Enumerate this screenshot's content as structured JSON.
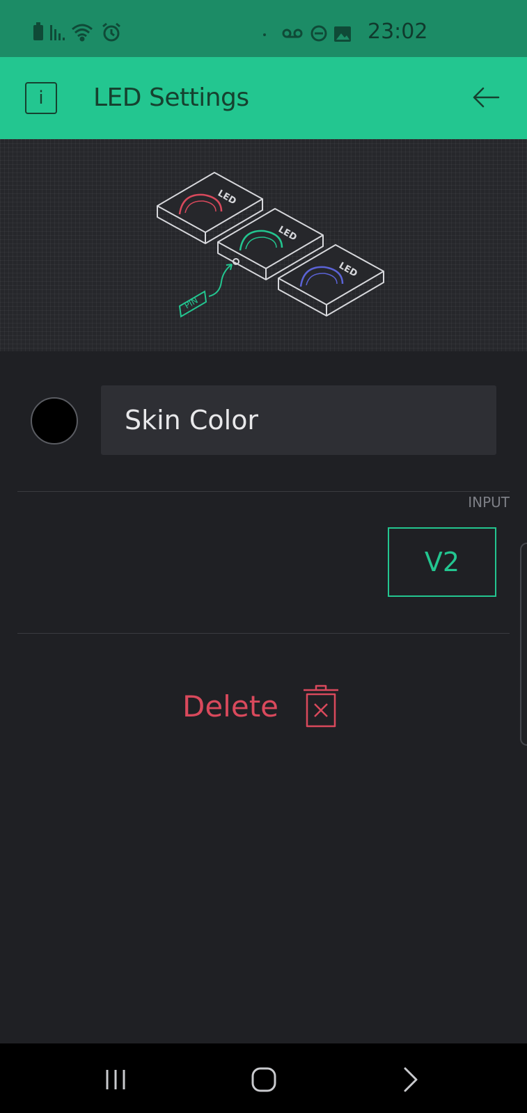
{
  "status_bar": {
    "time": "23:02",
    "icons_left": [
      "battery-icon",
      "signal-icon",
      "wifi-icon",
      "alarm-icon"
    ],
    "icons_right": [
      "dot-icon",
      "voicemail-icon",
      "do-not-disturb-icon",
      "image-icon"
    ]
  },
  "app_bar": {
    "info_label": "i",
    "title": "LED Settings",
    "back_icon": "arrow-left-icon"
  },
  "illustration": {
    "led_label": "LED",
    "pin_label": "PIN",
    "led_colors": [
      "#d9495c",
      "#23c690",
      "#5b63d6"
    ]
  },
  "form": {
    "swatch_color": "#000000",
    "name_value": "Skin Color",
    "input_label": "INPUT",
    "pin_value": "V2"
  },
  "delete": {
    "label": "Delete",
    "icon": "trash-icon",
    "color": "#d9495c"
  },
  "nav_bar": {
    "buttons": [
      "recent-apps-icon",
      "home-icon",
      "back-icon"
    ]
  },
  "colors": {
    "accent": "#23c690",
    "status_bar": "#1c8c66",
    "background": "#1f2024",
    "danger": "#d9495c"
  }
}
